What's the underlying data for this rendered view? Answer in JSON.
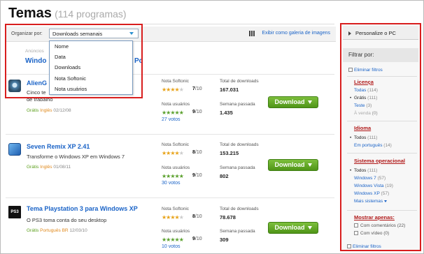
{
  "header": {
    "title": "Temas",
    "count": "(114 programas)"
  },
  "toolbar": {
    "sort_label": "Organizar por:",
    "sort_value": "Downloads semanais",
    "gallery_link": "Exibir como galeria de imagens"
  },
  "dropdown": {
    "options": [
      "Nome",
      "Data",
      "Downloads",
      "Nota Softonic",
      "Nota usuários"
    ]
  },
  "ads": {
    "label": "Anúncios",
    "partial_link": "Windo",
    "partial_tail": "Pc"
  },
  "items": [
    {
      "name": "AlienG",
      "description": "Cinco te ... o papel de parede e de trabalho",
      "desc1": "Cinco te",
      "desc2": "de trabalho",
      "license": "Grátis",
      "language": "Inglês",
      "date": "02/12/08",
      "softonic_label": "Nota Softonic",
      "softonic_score": "7",
      "softonic_max": "/10",
      "softonic_rating": 3.5,
      "user_label": "Nota usuários",
      "user_score": "9",
      "user_max": "/10",
      "user_rating": 4.5,
      "votes": "27 votos",
      "total_label": "Total de downloads",
      "total_value": "167.031",
      "week_label": "Semana passada",
      "week_value": "1.435",
      "download_label": "Download",
      "thumb_color": "#4a7fa8"
    },
    {
      "name": "Seven Remix XP 2.41",
      "desc1": "Transforme o Windows XP em Windows 7",
      "desc2": "",
      "license": "Grátis",
      "language": "Inglês",
      "date": "01/08/11",
      "softonic_label": "Nota Softonic",
      "softonic_score": "8",
      "softonic_max": "/10",
      "softonic_rating": 4,
      "user_label": "Nota usuários",
      "user_score": "9",
      "user_max": "/10",
      "user_rating": 4.5,
      "votes": "30 votos",
      "total_label": "Total de downloads",
      "total_value": "153.215",
      "week_label": "Semana passada",
      "week_value": "802",
      "download_label": "Download",
      "thumb_color": "#2c7fd6"
    },
    {
      "name": "Tema Playstation 3 para Windows XP",
      "desc1": "O PS3 toma conta do seu desktop",
      "desc2": "",
      "license": "Grátis",
      "language": "Português BR",
      "date": "12/03/10",
      "softonic_label": "Nota Softonic",
      "softonic_score": "8",
      "softonic_max": "/10",
      "softonic_rating": 4,
      "user_label": "Nota usuários",
      "user_score": "9",
      "user_max": "/10",
      "user_rating": 4.5,
      "votes": "10 votos",
      "total_label": "Total de downloads",
      "total_value": "78.678",
      "week_label": "Semana passada",
      "week_value": "309",
      "download_label": "Download",
      "thumb_color": "#111111"
    }
  ],
  "sidebar": {
    "personalize": "Personalize o PC",
    "filter_title": "Filtrar por:",
    "remove_filters": "Eliminar filtros",
    "license_title": "Licença",
    "license": [
      {
        "label": "Todas",
        "count": "(114)"
      },
      {
        "label": "Grátis",
        "count": "(111)"
      },
      {
        "label": "Teste",
        "count": "(3)"
      },
      {
        "label": "À venda",
        "count": "(0)"
      }
    ],
    "language_title": "Idioma",
    "language": [
      {
        "label": "Todos",
        "count": "(111)"
      },
      {
        "label": "Em português",
        "count": "(14)"
      }
    ],
    "os_title": "Sistema operacional",
    "os": [
      {
        "label": "Todos",
        "count": "(111)"
      },
      {
        "label": "Windows 7",
        "count": "(57)"
      },
      {
        "label": "Windows Vista",
        "count": "(19)"
      },
      {
        "label": "Windows XP",
        "count": "(57)"
      },
      {
        "label": "Mais sistemas",
        "count": ""
      }
    ],
    "show_title": "Mostrar apenas:",
    "show": [
      {
        "label": "Com comentários",
        "count": "(22)"
      },
      {
        "label": "Com vídeo",
        "count": "(0)"
      }
    ],
    "remove_filters_bottom": "Eliminar filtros"
  },
  "colors": {
    "link": "#1a63c7",
    "highlight_border": "#d81e1e",
    "download_green": "#5aa02c",
    "star_orange": "#e8a319"
  }
}
